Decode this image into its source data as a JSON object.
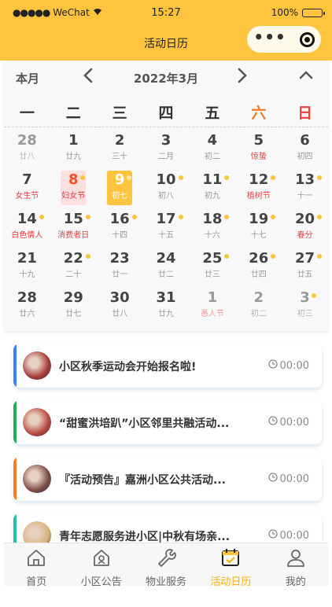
{
  "status_bar": {
    "signal": "●●●●●",
    "carrier": "WeChat",
    "time": "15:27",
    "battery": "100%"
  },
  "nav": {
    "title": "活动日历",
    "more_icon": "more-dots-icon",
    "close_icon": "capsule-close-icon"
  },
  "calendar": {
    "mode_label": "本月",
    "month_label": "2022年3月",
    "prev": "‹",
    "next": "›",
    "weekdays": [
      "一",
      "二",
      "三",
      "四",
      "五",
      "六",
      "日"
    ],
    "days": [
      {
        "n": "28",
        "l": "廿八",
        "other": true
      },
      {
        "n": "1",
        "l": "廿九"
      },
      {
        "n": "2",
        "l": "三十"
      },
      {
        "n": "3",
        "l": "二月"
      },
      {
        "n": "4",
        "l": "初二"
      },
      {
        "n": "5",
        "l": "惊蛰",
        "red": true
      },
      {
        "n": "6",
        "l": "初四"
      },
      {
        "n": "7",
        "l": "女生节",
        "red": true
      },
      {
        "n": "8",
        "l": "妇女节",
        "red": true,
        "dot": true,
        "tag": "red"
      },
      {
        "n": "9",
        "l": "初七",
        "dot": true,
        "tag": "today"
      },
      {
        "n": "10",
        "l": "初八",
        "dot": true
      },
      {
        "n": "11",
        "l": "初九",
        "dot": true
      },
      {
        "n": "12",
        "l": "植树节",
        "red": true,
        "dot": true
      },
      {
        "n": "13",
        "l": "十一",
        "dot": true
      },
      {
        "n": "14",
        "l": "白色情人",
        "red": true,
        "dot": true,
        "multi": true
      },
      {
        "n": "15",
        "l": "消费者日",
        "red": true,
        "dot": true,
        "multi": true
      },
      {
        "n": "16",
        "l": "十四",
        "dot": true
      },
      {
        "n": "17",
        "l": "十五",
        "dot": true
      },
      {
        "n": "18",
        "l": "十六",
        "dot": true
      },
      {
        "n": "19",
        "l": "十七",
        "dot": true
      },
      {
        "n": "20",
        "l": "春分",
        "red": true,
        "dot": true
      },
      {
        "n": "21",
        "l": "十九"
      },
      {
        "n": "22",
        "l": "二十",
        "dot": true
      },
      {
        "n": "23",
        "l": "廿一"
      },
      {
        "n": "24",
        "l": "廿二"
      },
      {
        "n": "25",
        "l": "廿三",
        "dot": true
      },
      {
        "n": "26",
        "l": "廿四",
        "dot": true
      },
      {
        "n": "27",
        "l": "廿五",
        "dot": true
      },
      {
        "n": "28",
        "l": "廿六"
      },
      {
        "n": "29",
        "l": "廿七"
      },
      {
        "n": "30",
        "l": "廿八"
      },
      {
        "n": "31",
        "l": "廿九"
      },
      {
        "n": "1",
        "l": "愚人节",
        "red": true,
        "other": true
      },
      {
        "n": "2",
        "l": "初二",
        "other": true
      },
      {
        "n": "3",
        "l": "初三",
        "other": true,
        "dot": true
      }
    ]
  },
  "activities": [
    {
      "title": "小区秋季运动会开始报名啦!",
      "time": "00:00",
      "accent": "#3B82F6",
      "thumb": "#a33a3a"
    },
    {
      "title": "“甜蜜洪培趴”小区邻里共融活动...",
      "time": "00:00",
      "accent": "#22B04B",
      "thumb": "#b8473e"
    },
    {
      "title": "『活动预告』嘉洲小区公共活动...",
      "time": "00:00",
      "accent": "#F47B2A",
      "thumb": "#7a4b45"
    },
    {
      "title": "青年志愿服务进小区|中秋有场亲...",
      "time": "00:00",
      "accent": "#1FBFB0",
      "thumb": "#d9b37a"
    }
  ],
  "tabs": [
    {
      "label": "首页",
      "icon": "home-icon"
    },
    {
      "label": "小区公告",
      "icon": "community-notice-icon"
    },
    {
      "label": "物业服务",
      "icon": "wrench-service-icon"
    },
    {
      "label": "活动日历",
      "icon": "calendar-icon",
      "active": true
    },
    {
      "label": "我的",
      "icon": "user-icon"
    }
  ],
  "colors": {
    "brand": "#FFC43D",
    "active_tab": "#FFB000",
    "holiday_red": "#E64040",
    "saturday": "#F47B2A"
  }
}
